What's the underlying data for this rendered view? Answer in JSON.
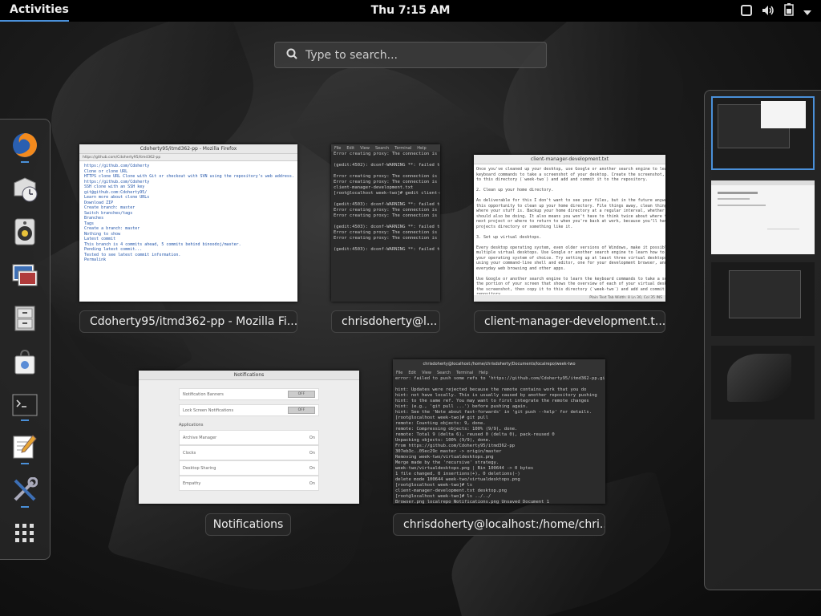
{
  "topbar": {
    "activities": "Activities",
    "clock": "Thu  7:15 AM"
  },
  "search": {
    "placeholder": "Type to search..."
  },
  "dash": {
    "items": [
      {
        "name": "firefox",
        "running": true
      },
      {
        "name": "mail-clock",
        "running": false
      },
      {
        "name": "speaker",
        "running": false
      },
      {
        "name": "image-viewer",
        "running": false
      },
      {
        "name": "file-cabinet",
        "running": false
      },
      {
        "name": "software-bag",
        "running": false
      },
      {
        "name": "terminal",
        "running": true
      },
      {
        "name": "text-editor",
        "running": true
      },
      {
        "name": "settings-tools",
        "running": true
      },
      {
        "name": "app-grid",
        "running": false
      }
    ]
  },
  "windows": {
    "firefox": {
      "label": "Cdoherty95/itmd362-pp - Mozilla Fi...",
      "title": "Cdoherty95/itmd362-pp - Mozilla Firefox",
      "url": "https://github.com/Cdoherty95/itmd362-pp",
      "lines": [
        "https://github.com/Cdoherty",
        "Clone or clone URL",
        "HTTPS clone URL  Clone with Git or checkout with SVN using the repository's web address.",
        "https://github.com/Cdoherty",
        "SSH clone with an SSH key",
        "git@github.com:Cdoherty95/",
        "Learn more about clone URLs",
        "Download ZIP",
        "Create branch: master",
        "Switch branches/tags",
        "Branches",
        "Tags",
        "Create a branch: master",
        "Nothing to show",
        "Latest commit",
        "This branch is 4 commits ahead, 5 commits behind binoodoj/master.",
        "Pending latest commit...",
        "Tested to see latest commit information.",
        "Permalink"
      ]
    },
    "terminal_small": {
      "label": "chrisdoherty@l...",
      "lines": [
        "Error creating proxy: The connection is closed (g-io-error-quark, 18)",
        "",
        "(gedit:4502): dconf-WARNING **: failed to commit changes to dconf: The connection is closed",
        "",
        "Error creating proxy: The connection is closed (g-io-error-quark, 18)",
        "Error creating proxy: The connection is closed",
        "client-manager-development.txt",
        "[root@localhost week-two]# gedit client-manager-development.txt",
        "",
        "(gedit:4503): dconf-WARNING **: failed to commit changes to dconf: The connection is closed",
        "Error creating proxy: The connection is closed (g-io-error-quark, 18)",
        "Error creating proxy: The connection is closed",
        "",
        "(gedit:4503): dconf-WARNING **: failed to commit changes to dconf: The connection is closed",
        "Error creating proxy: The connection is closed (g-io-error-quark, 18)",
        "Error creating proxy: The connection is closed",
        "",
        "(gedit:4503): dconf-WARNING **: failed to commit changes to dconf: The connection is closed"
      ]
    },
    "gedit": {
      "label": "client-manager-development.t...",
      "title": "client-manager-development.txt",
      "lines": [
        "Once you've cleaned up your desktop, use Google or another search engine to learn the",
        "keyboard commands to take a screenshot of your desktop. Create the screenshot, then copy it",
        "to this directory (`week-two`) and add and commit it to the repository.",
        "",
        "2. Clean up your home directory.",
        "",
        "As deliverable for this I don't want to see your files, but in the future anyway, take",
        "this opportunity to clean up your home directory. File things away, clean things up. Know",
        "where your stuff is. Backup your home directory at a regular interval, whether you",
        "should also be doing. It also means you won't have to think twice about where to start your",
        "next project or where to return to when you're back at work, because you'll have a",
        "projects directory or something like it.",
        "",
        "3. Set up virtual desktops.",
        "",
        "Every desktop operating system, even older versions of Windows, make it possible to set up",
        "multiple virtual desktops. Use Google or another search engine to learn how to do this on",
        "your operating system of choice. Try setting up at least three virtual desktops: one for",
        "using your command-line shell and editor, one for your development browser, and one for your",
        "everyday web browsing and other apps.",
        "",
        "Use Google or another search engine to learn the keyboard commands to take a screenshot of",
        "the portion of your screen that shows the overview of each of your virtual desktops. Create",
        "the screenshot, then copy it to this directory (`week-two`) and add and commit it to the",
        "repository.",
        "",
        "Then, also list here the keyboard commands to switch between your different virtual desktops",
        "(as each operating system, you might be able to customize the shortcuts to your own liking).",
        "",
        "4. Set up a destination-free browser."
      ],
      "status": "Plain Text  Tab Width: 8  Ln 30, Col 35  INS"
    },
    "notifications": {
      "label": "Notifications",
      "title": "Notifications",
      "rows": [
        {
          "label": "Notification Banners",
          "state": "OFF"
        },
        {
          "label": "Lock Screen Notifications",
          "state": "OFF"
        }
      ],
      "section": "Applications",
      "apps": [
        {
          "label": "Archive Manager",
          "state": "On"
        },
        {
          "label": "Clocks",
          "state": "On"
        },
        {
          "label": "Desktop Sharing",
          "state": "On"
        },
        {
          "label": "Empathy",
          "state": "On"
        }
      ]
    },
    "terminal_large": {
      "label": "chrisdoherty@localhost:/home/chri...",
      "title": "chrisdoherty@localhost:/home/chrisdoherty/Documents/localrepo/week-two",
      "menu": [
        "File",
        "Edit",
        "View",
        "Search",
        "Terminal",
        "Help"
      ],
      "lines": [
        "error: failed to push some refs to 'https://github.com/Cdoherty95/itmd362-pp.git'",
        "",
        "hint: Updates were rejected because the remote contains work that you do",
        "hint: not have locally. This is usually caused by another repository pushing",
        "hint: to the same ref. You may want to first integrate the remote changes",
        "hint: (e.g., 'git pull ...') before pushing again.",
        "hint: See the 'Note about fast-forwards' in 'git push --help' for details.",
        "[root@localhost week-two]# git pull",
        "remote: Counting objects: 9, done.",
        "remote: Compressing objects: 100% (9/9), done.",
        "remote: Total 9 (delta 6), reused 0 (delta 0), pack-reused 0",
        "Unpacking objects: 100% (9/9), done.",
        "From https://github.com/Cdoherty95/itmd362-pp",
        "   307eb3c..05ec29c  master     -> origin/master",
        "Removing week-two/virtualdesktops.png",
        "Merge made by the 'recursive' strategy.",
        " week-two/virtualdesktops.png | Bin 100644 -> 0 bytes",
        " 1 file changed, 0 insertions(+), 0 deletions(-)",
        " delete mode 100644 week-two/virtualdesktops.png",
        "[root@localhost week-two]# ls",
        "client-manager-development.txt  desktop.png",
        "[root@localhost week-two]# ls ../../",
        "Browser.png  localrepo  Notifications.png  Unsaved Document 1",
        "[root@localhost week-two]# "
      ]
    }
  },
  "workspaces": [
    {
      "active": true
    },
    {
      "active": false
    },
    {
      "active": false
    },
    {
      "active": false
    }
  ],
  "colors": {
    "accent": "#4a90d9",
    "topbar": "#000000"
  }
}
